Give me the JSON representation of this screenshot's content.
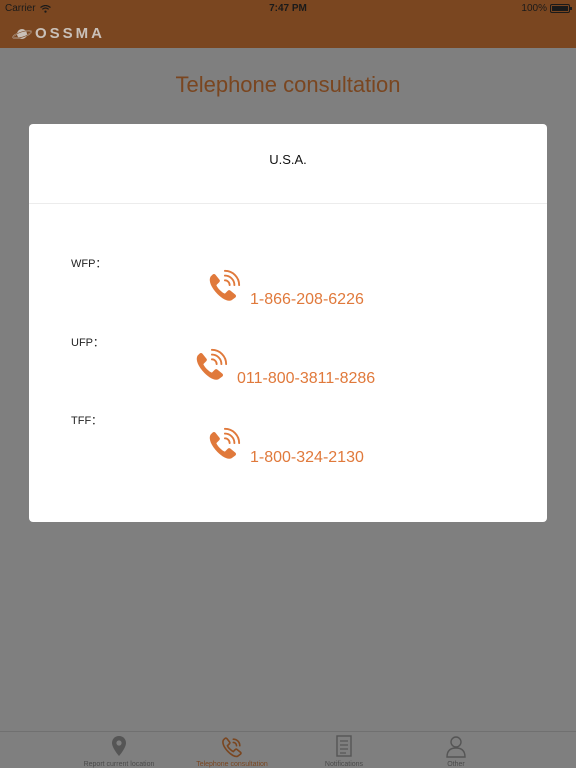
{
  "status_bar": {
    "carrier": "Carrier",
    "time": "7:47 PM",
    "battery": "100%",
    "battery_level": 1.0
  },
  "nav": {
    "logo_text": "OSSMA",
    "logo_icon": "planet-icon"
  },
  "page": {
    "title": "Telephone consultation"
  },
  "modal": {
    "country": "U.S.A.",
    "entries": [
      {
        "label": "WFP：",
        "number": "1-866-208-6226",
        "icon": "phone-icon"
      },
      {
        "label": "UFP：",
        "number": "011-800-3811-8286",
        "icon": "phone-icon"
      },
      {
        "label": "TFF：",
        "number": "1-800-324-2130",
        "icon": "phone-icon"
      }
    ]
  },
  "tabbar": {
    "tabs": [
      {
        "label": "Report current location",
        "icon": "map-pin-icon",
        "active": false
      },
      {
        "label": "Telephone consultation",
        "icon": "phone-icon",
        "active": true
      },
      {
        "label": "Notifications",
        "icon": "document-icon",
        "active": false
      },
      {
        "label": "Other",
        "icon": "person-icon",
        "active": false
      }
    ]
  },
  "colors": {
    "brand": "#7a4620",
    "accent": "#e0793b",
    "overlay": "#7f7f7f"
  }
}
